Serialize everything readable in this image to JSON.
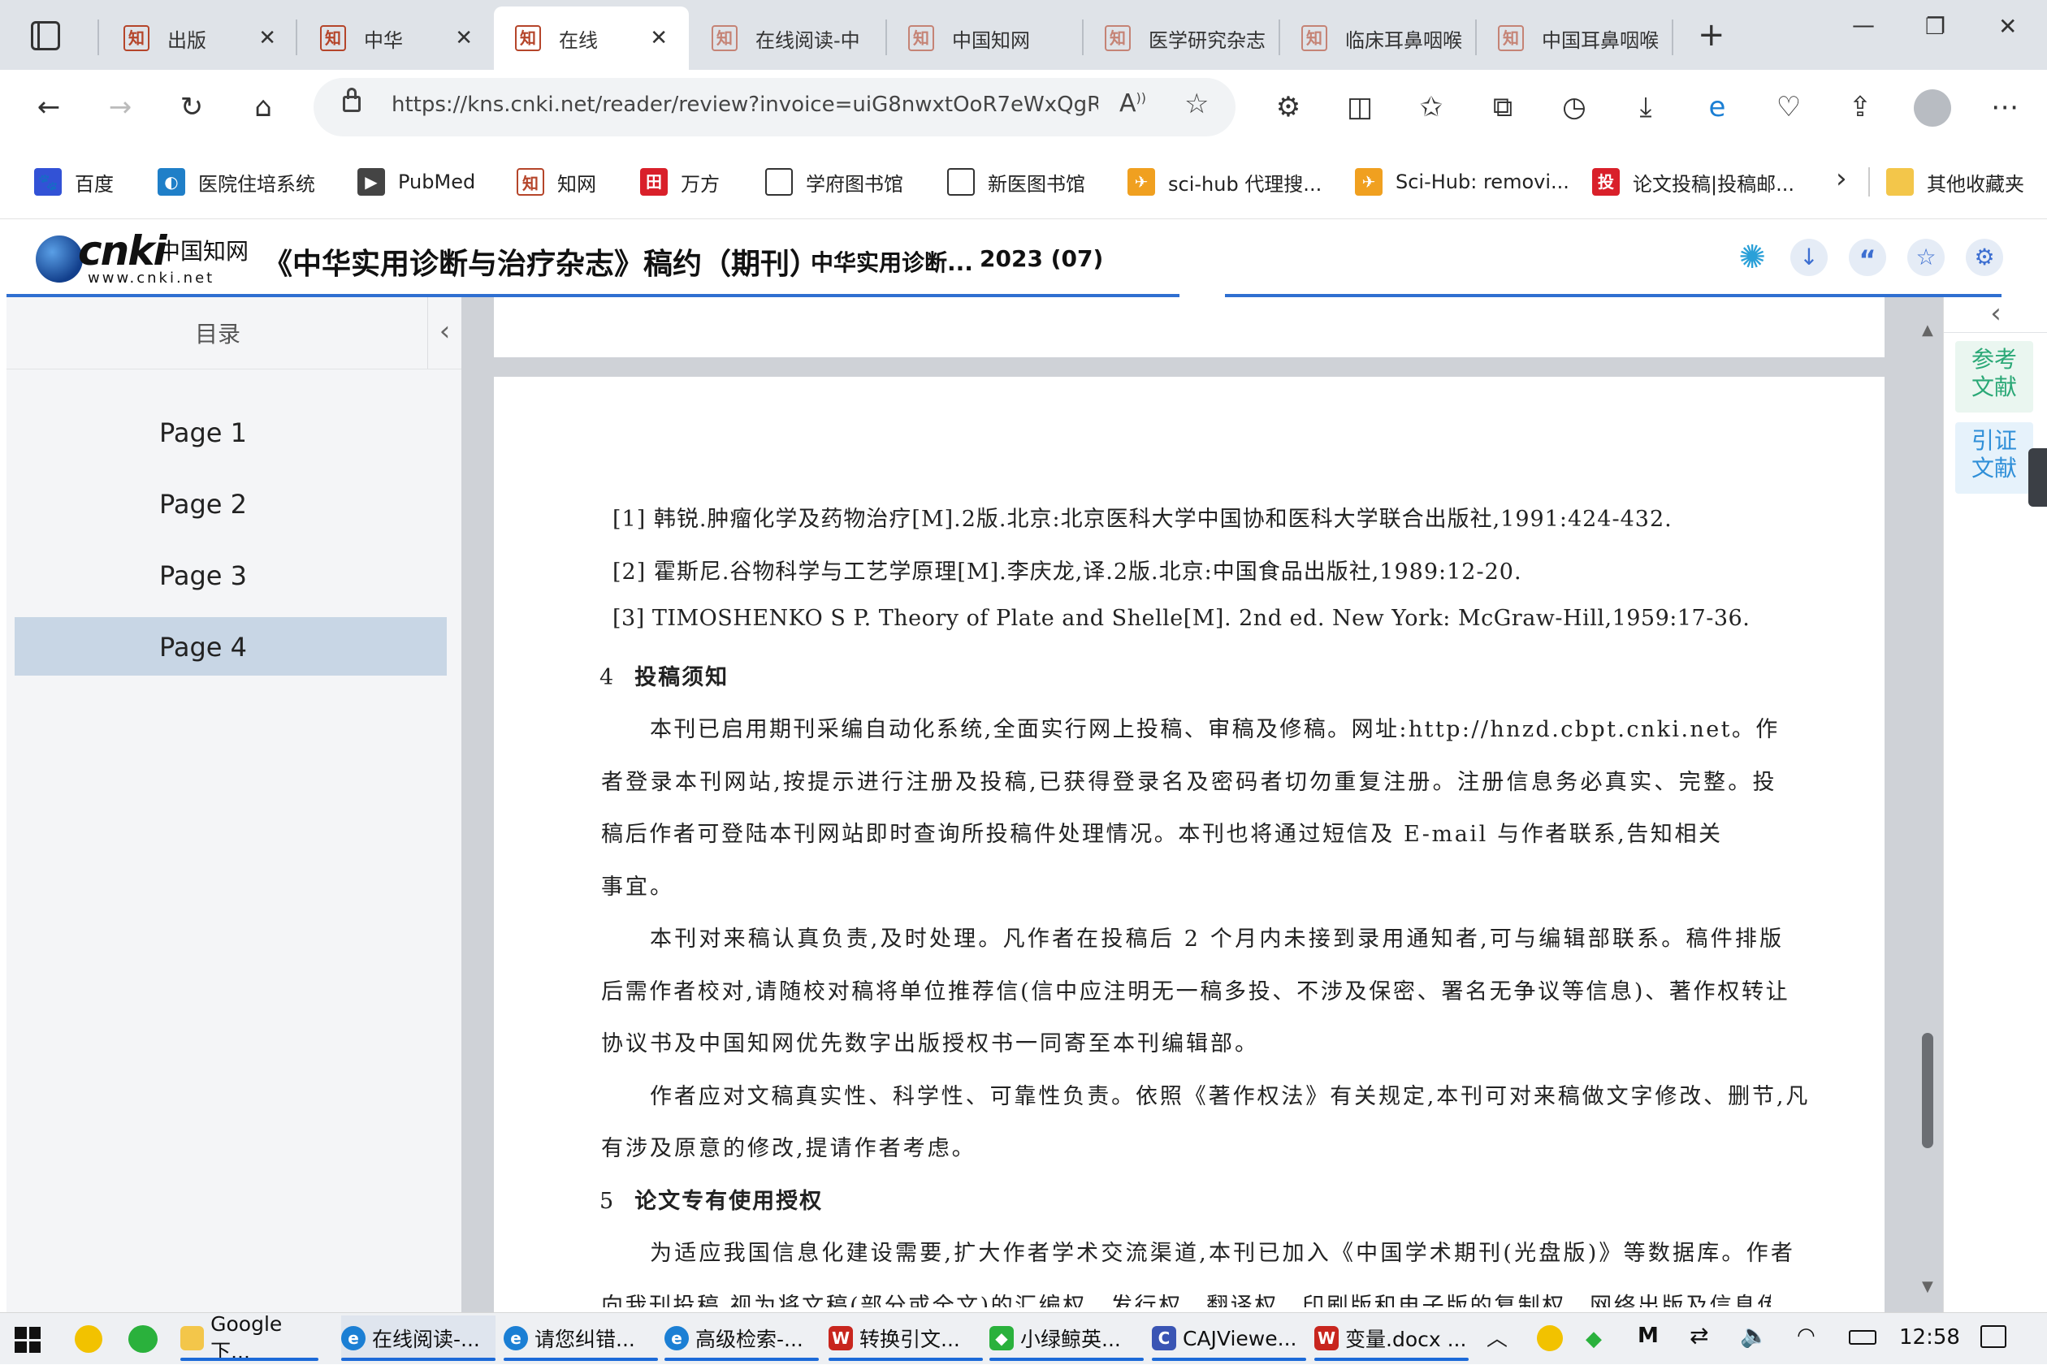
{
  "tabs": [
    {
      "title": "出版"
    },
    {
      "title": "中华"
    },
    {
      "title": "在线"
    },
    {
      "title": "在线阅读-中"
    },
    {
      "title": "中国知网"
    },
    {
      "title": "医学研究杂志"
    },
    {
      "title": "临床耳鼻咽喉"
    },
    {
      "title": "中国耳鼻咽喉"
    }
  ],
  "window": {
    "minimize": "—",
    "restore": "❐",
    "close": "✕",
    "new_tab": "+"
  },
  "address": {
    "url": "https://kns.cnki.net/reader/review?invoice=uiG8nwxtOoR7eWxQgRK..."
  },
  "bookmarks": [
    "百度",
    "医院住培系统",
    "PubMed",
    "知网",
    "万方",
    "学府图书馆",
    "新医图书馆",
    "sci-hub 代理搜...",
    "Sci-Hub: removi...",
    "论文投稿|投稿邮...",
    "其他收藏夹"
  ],
  "cnki": {
    "logo_main": "cnki",
    "logo_cn": "中国知网",
    "logo_url": "www.cnki.net",
    "title": "《中华实用诊断与治疗杂志》稿约（期刊）",
    "journal": "中华实用诊断...",
    "issue": "2023 (07)"
  },
  "toc": {
    "heading": "目录",
    "pages": [
      "Page 1",
      "Page 2",
      "Page 3",
      "Page 4"
    ],
    "active_index": 3
  },
  "document": {
    "refs": [
      "[1]  韩锐.肿瘤化学及药物治疗[M].2版.北京:北京医科大学中国协和医科大学联合出版社,1991:424-432.",
      "[2]  霍斯尼.谷物科学与工艺学原理[M].李庆龙,译.2版.北京:中国食品出版社,1989:12-20.",
      "[3]  TIMOSHENKO S P. Theory of Plate and Shelle[M]. 2nd ed. New York: McGraw-Hill,1959:17-36."
    ],
    "section4": {
      "num": "4",
      "title": "投稿须知"
    },
    "section4_lines": [
      "本刊已启用期刊采编自动化系统,全面实行网上投稿、审稿及修稿。网址:http://hnzd.cbpt.cnki.net。作",
      "者登录本刊网站,按提示进行注册及投稿,已获得登录名及密码者切勿重复注册。注册信息务必真实、完整。投",
      "稿后作者可登陆本刊网站即时查询所投稿件处理情况。本刊也将通过短信及 E-mail 与作者联系,告知相关",
      "事宜。",
      "本刊对来稿认真负责,及时处理。凡作者在投稿后 2 个月内未接到录用通知者,可与编辑部联系。稿件排版",
      "后需作者校对,请随校对稿将单位推荐信(信中应注明无一稿多投、不涉及保密、署名无争议等信息)、著作权转让",
      "协议书及中国知网优先数字出版授权书一同寄至本刊编辑部。",
      "作者应对文稿真实性、科学性、可靠性负责。依照《著作权法》有关规定,本刊可对来稿做文字修改、删节,凡",
      "有涉及原意的修改,提请作者考虑。"
    ],
    "section5": {
      "num": "5",
      "title": "论文专有使用授权"
    },
    "section5_lines": [
      "为适应我国信息化建设需要,扩大作者学术交流渠道,本刊已加入《中国学术期刊(光盘版)》等数据库。作者",
      "向我刊投稿,视为将文稿(部分或全文)的汇编权、发行权、翻译权、印刷版和电子版的复制权、网络出版及信息传"
    ]
  },
  "right_panel": {
    "references": "参考文献",
    "citations": "引证文献"
  },
  "taskbar": {
    "items": [
      "Google下...",
      "在线阅读-...",
      "请您纠错...",
      "高级检索-...",
      "转换引文...",
      "小绿鲸英...",
      "CAJViewe...",
      "变量.docx ..."
    ],
    "time": "12:58"
  },
  "colors": {
    "accent": "#2f6fd1",
    "toc_active": "#c8d6e5",
    "ref_green": "#2aa876",
    "cite_blue": "#2f8fd8"
  }
}
